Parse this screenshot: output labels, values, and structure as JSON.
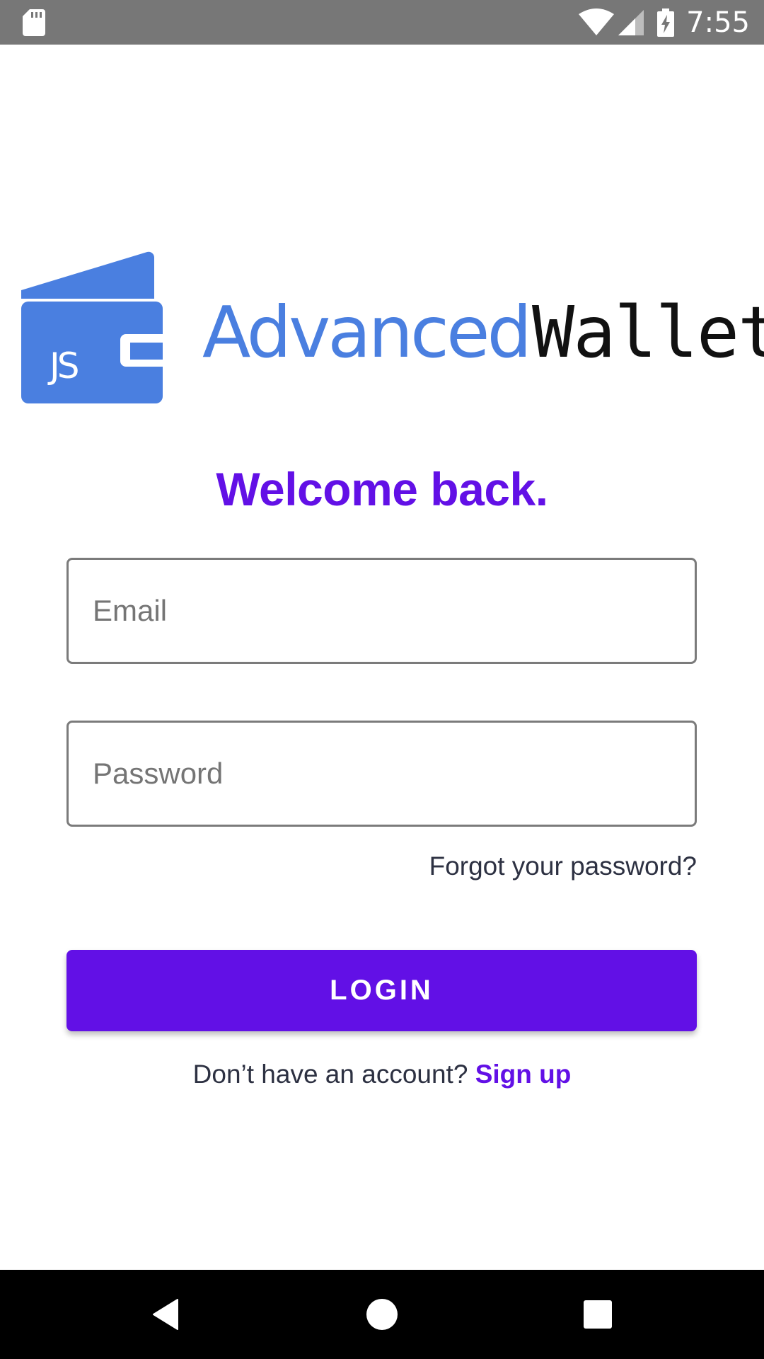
{
  "status_bar": {
    "time": "7:55",
    "icons": [
      "sd-card-icon",
      "wifi-icon",
      "signal-icon",
      "battery-charging-icon"
    ]
  },
  "logo": {
    "badge_text": "JS",
    "word_1": "Advanced",
    "word_2": "Wallet",
    "colors": {
      "wallet_blue": "#4a7fe0",
      "wordmark_dark": "#111111"
    }
  },
  "login_form": {
    "title": "Welcome back.",
    "email_placeholder": "Email",
    "password_placeholder": "Password",
    "forgot_password": "Forgot your password?",
    "login_button": "LOGIN",
    "signup_prompt": "Don’t have an account?",
    "signup_link": "Sign up"
  },
  "nav_bar": {
    "icons": [
      "back-icon",
      "home-icon",
      "recents-icon"
    ]
  },
  "colors": {
    "accent": "#6210e6",
    "status_bar": "#777777",
    "text_dark": "#2d3142"
  }
}
